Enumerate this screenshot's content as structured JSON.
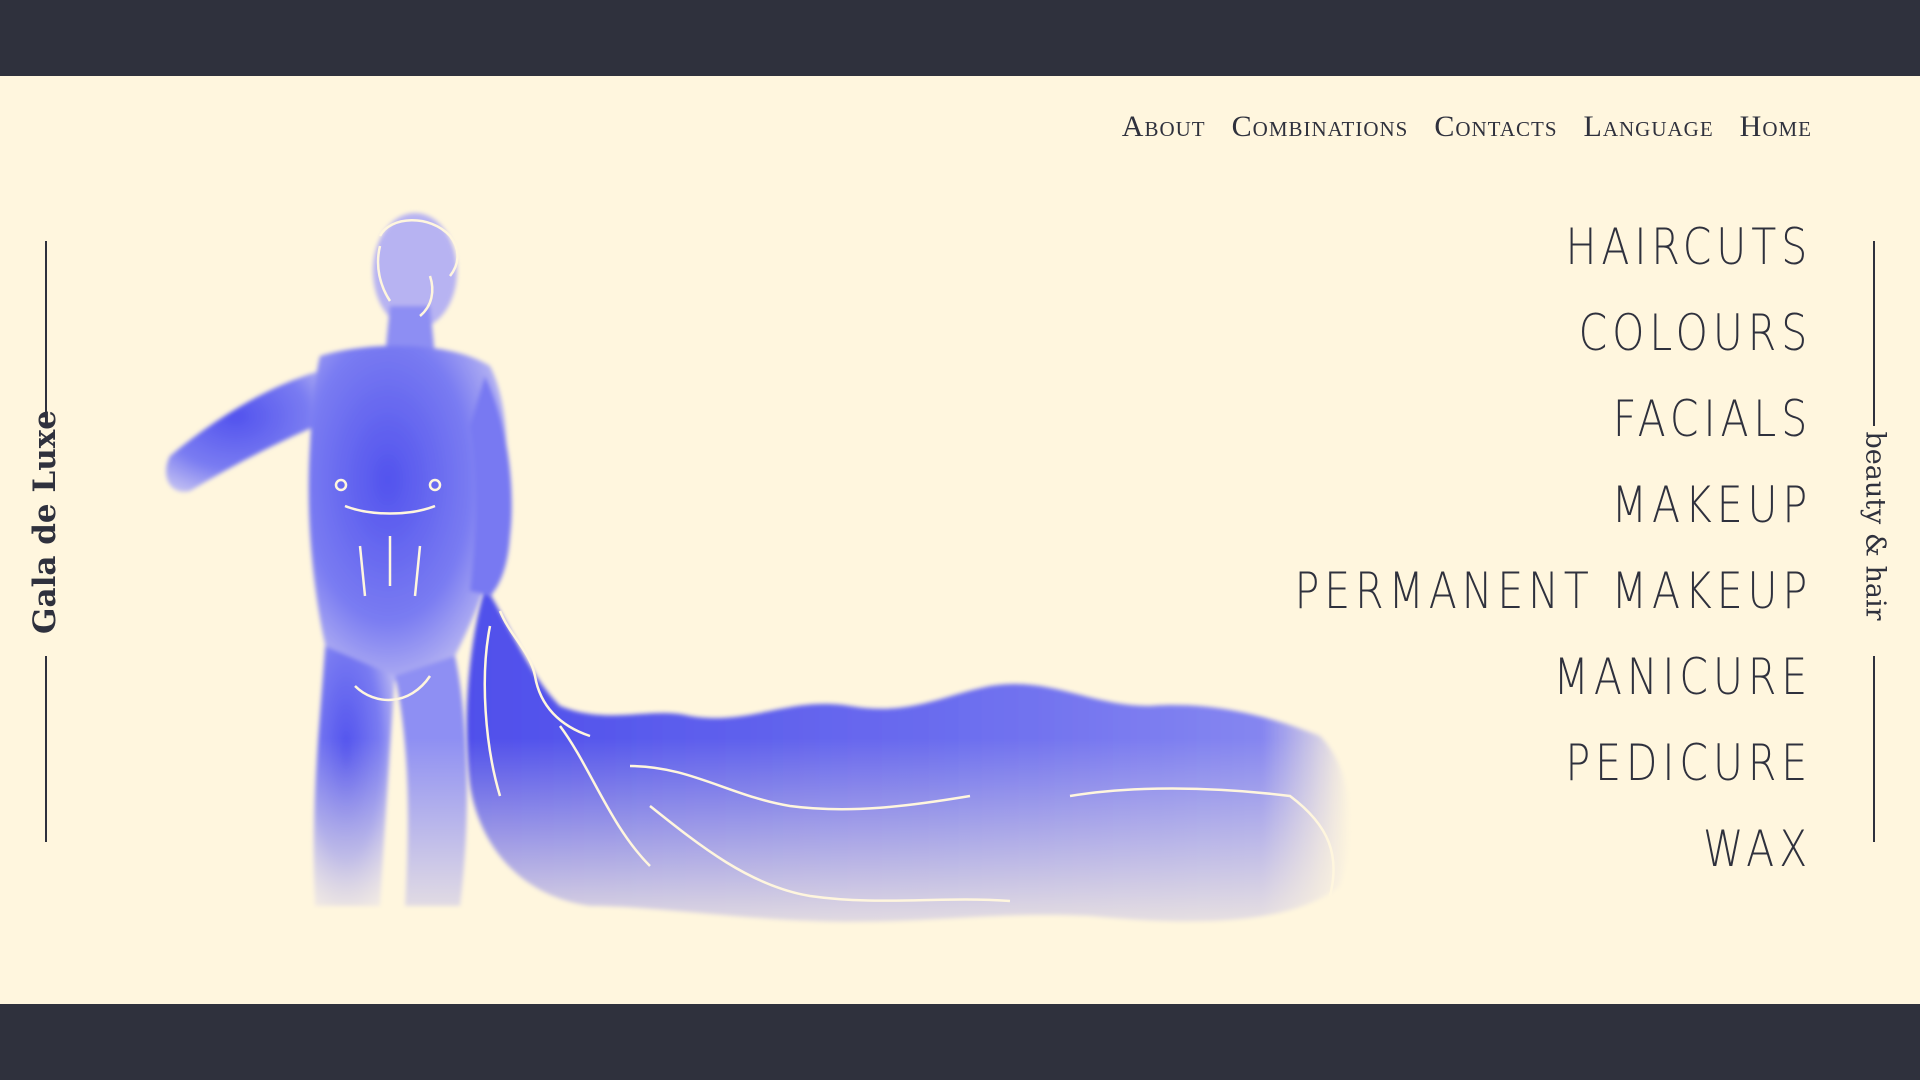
{
  "brand": {
    "name": "Gala de Luxe",
    "tagline": "beauty & hair"
  },
  "nav": {
    "items": [
      "About",
      "Combinations",
      "Contacts",
      "Language",
      "Home"
    ]
  },
  "services": {
    "items": [
      "Haircuts",
      "Colours",
      "Facials",
      "Makeup",
      "Permanent Makeup",
      "Manicure",
      "Pedicure",
      "Wax"
    ]
  },
  "hero": {
    "illustration_icon": "classical-statue-with-drapery",
    "fill_color": "#5b5cf0",
    "line_color": "#fff6de"
  },
  "colors": {
    "frame": "#2f313d",
    "background": "#fff6de",
    "text": "#2f313d",
    "accent": "#5b5cf0"
  }
}
